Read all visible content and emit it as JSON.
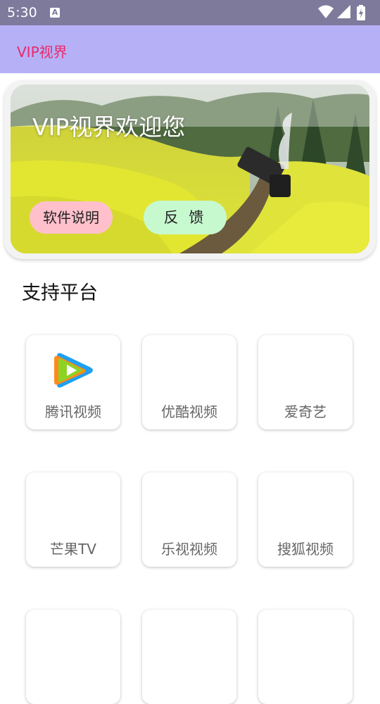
{
  "status_bar": {
    "time": "5:30",
    "notification_icon_letter": "A"
  },
  "app_bar": {
    "title": "VIP视界"
  },
  "banner": {
    "title": "VIP视界欢迎您",
    "buttons": {
      "description": "软件说明",
      "feedback": "反 馈"
    }
  },
  "section": {
    "title": "支持平台"
  },
  "platforms": [
    {
      "label": "腾讯视频",
      "icon": "tencent-video-icon"
    },
    {
      "label": "优酷视频"
    },
    {
      "label": "爱奇艺"
    },
    {
      "label": "芒果TV"
    },
    {
      "label": "乐视视频"
    },
    {
      "label": "搜狐视频"
    },
    {
      "label": ""
    },
    {
      "label": ""
    },
    {
      "label": ""
    }
  ],
  "colors": {
    "status_bar": "#7e7a9c",
    "app_bar": "#b6b1f7",
    "app_title": "#e8296a",
    "desc_button": "#ffc0cb",
    "feedback_button": "#c7f9cf"
  }
}
